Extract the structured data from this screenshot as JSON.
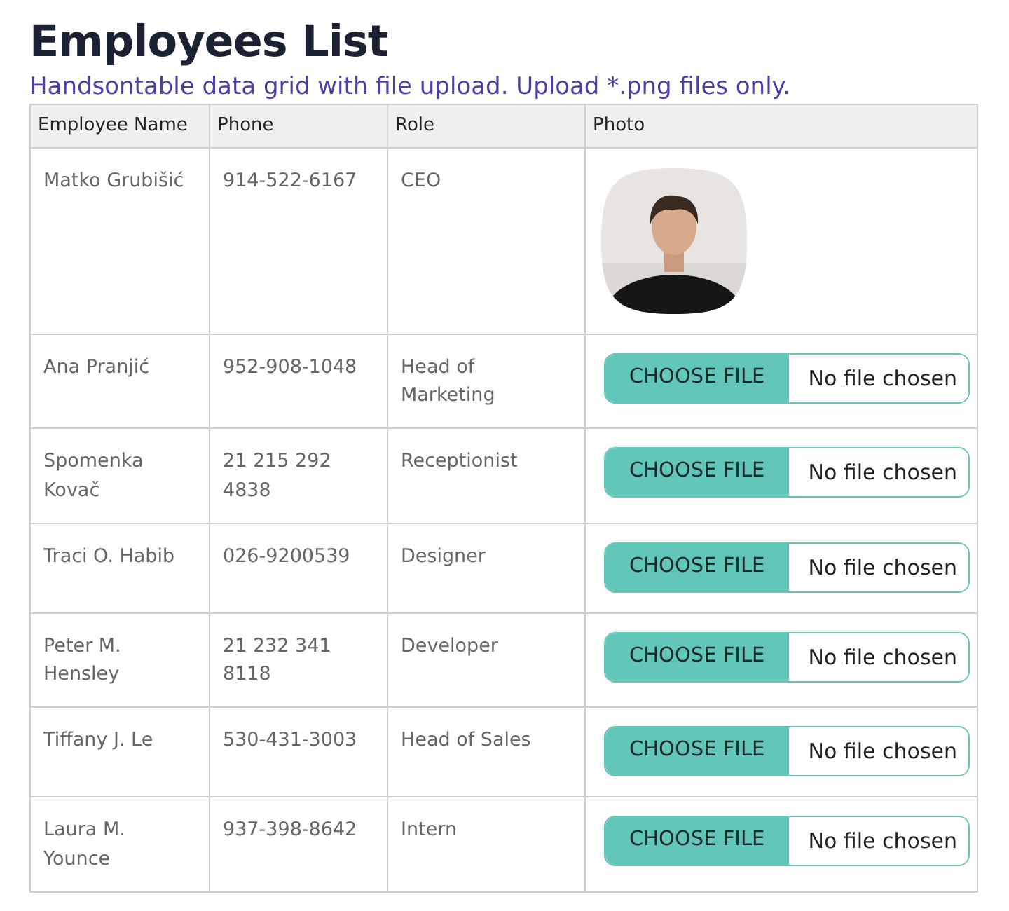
{
  "title": "Employees List",
  "subtitle": "Handsontable data grid with file upload. Upload *.png files only.",
  "table": {
    "columns": [
      "Employee Name",
      "Phone",
      "Role",
      "Photo"
    ],
    "rows": [
      {
        "name": "Matko Grubišić",
        "phone": "914-522-6167",
        "role": "CEO"
      },
      {
        "name": "Ana Pranjić",
        "phone": "952-908-1048",
        "role": "Head of Marketing",
        "photo": {
          "kind": "upload",
          "button": "CHOOSE FILE",
          "status": "No file chosen"
        }
      },
      {
        "name": "Spomenka Kovač",
        "phone": "21 215 292 4838",
        "role": "Receptionist",
        "photo": {
          "kind": "upload",
          "button": "CHOOSE FILE",
          "status": "No file chosen"
        }
      },
      {
        "name": "Traci O. Habib",
        "phone": "026-9200539",
        "role": "Designer",
        "photo": {
          "kind": "upload",
          "button": "CHOOSE FILE",
          "status": "No file chosen"
        }
      },
      {
        "name": "Peter M. Hensley",
        "phone": "21 232 341 8118",
        "role": "Developer",
        "photo": {
          "kind": "upload",
          "button": "CHOOSE FILE",
          "status": "No file chosen"
        }
      },
      {
        "name": "Tiffany J. Le",
        "phone": "530-431-3003",
        "role": "Head of Sales",
        "photo": {
          "kind": "upload",
          "button": "CHOOSE FILE",
          "status": "No file chosen"
        }
      },
      {
        "name": "Laura M. Younce",
        "phone": "937-398-8642",
        "role": "Intern",
        "photo": {
          "kind": "upload",
          "button": "CHOOSE FILE",
          "status": "No file chosen"
        }
      }
    ]
  }
}
